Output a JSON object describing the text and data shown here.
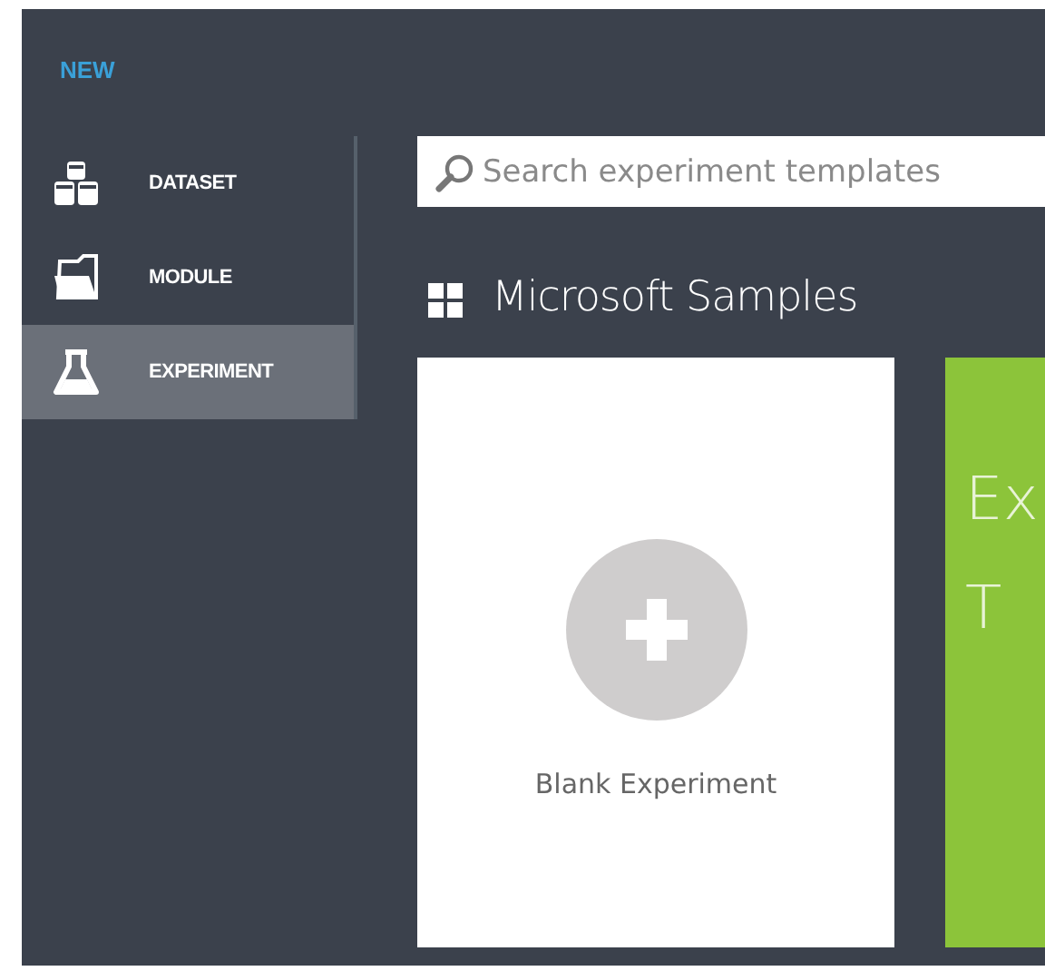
{
  "header": {
    "title": "NEW"
  },
  "sidebar": {
    "items": [
      {
        "label": "DATASET",
        "kind": "dataset",
        "selected": false
      },
      {
        "label": "MODULE",
        "kind": "module",
        "selected": false
      },
      {
        "label": "EXPERIMENT",
        "kind": "experiment",
        "selected": true
      }
    ]
  },
  "search": {
    "placeholder": "Search experiment templates"
  },
  "section": {
    "title": "Microsoft Samples"
  },
  "tiles": [
    {
      "kind": "blank",
      "label": "Blank Experiment"
    },
    {
      "kind": "sample",
      "lines": [
        "Ex",
        "T"
      ],
      "color": "#8cc43a"
    }
  ]
}
